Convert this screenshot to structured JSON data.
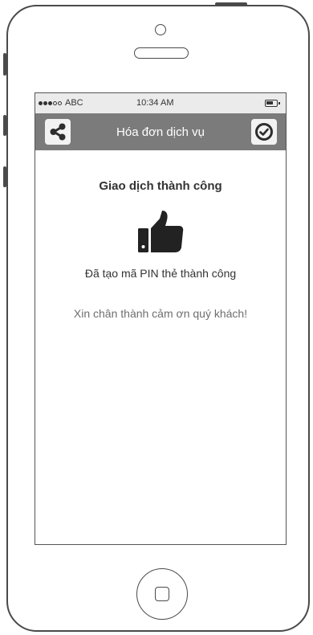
{
  "status_bar": {
    "carrier": "ABC",
    "time": "10:34 AM"
  },
  "nav": {
    "title": "Hóa đơn dịch vụ",
    "left_icon": "share-icon",
    "right_icon": "check-circle-icon"
  },
  "main": {
    "headline": "Giao dịch thành công",
    "icon": "thumbs-up-icon",
    "pin_message": "Đã tạo mã PIN thẻ thành công",
    "thanks_message": "Xin chân thành cảm ơn quý khách!"
  },
  "colors": {
    "nav_bar": "#7b7b7b",
    "status_bar": "#ebebeb",
    "text_dark": "#333333",
    "text_muted": "#6e6e6e"
  }
}
